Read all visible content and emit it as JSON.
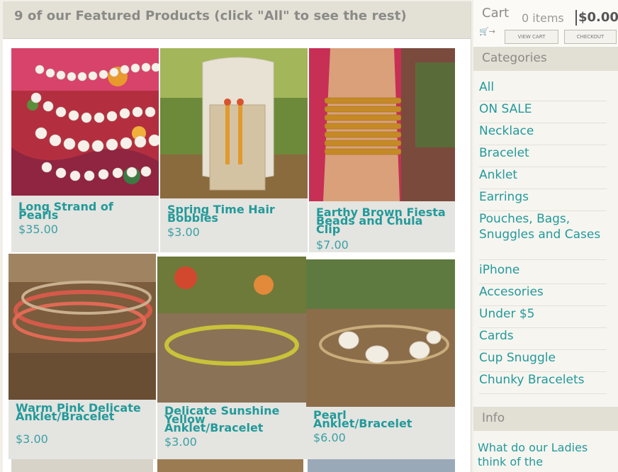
{
  "main": {
    "title": "9 of our Featured Products (click \"All\" to see the rest)",
    "products": [
      {
        "name": "Long Strand of Pearls",
        "price": "$35.00"
      },
      {
        "name": "Spring Time Hair Bobbles",
        "price": "$3.00"
      },
      {
        "name": "Earthy Brown Fiesta Beads and Chula Clip",
        "price": "$7.00"
      },
      {
        "name": "Warm Pink Delicate Anklet/Bracelet",
        "price": "$3.00"
      },
      {
        "name": "Delicate Sunshine Yellow Anklet/Bracelet",
        "price": "$3.00"
      },
      {
        "name": "Pearl Anklet/Bracelet",
        "price": "$6.00"
      }
    ]
  },
  "cart": {
    "label": "Cart",
    "items": "0 items",
    "total": "$0.00",
    "view_cart": "VIEW CART",
    "checkout": "CHECKOUT"
  },
  "categories": {
    "title": "Categories",
    "items": [
      "All",
      "ON SALE",
      "Necklace",
      "Bracelet",
      "Anklet",
      "Earrings",
      "Pouches, Bags, Snuggles and Cases",
      "iPhone",
      "Accesories",
      "Under $5",
      "Cards",
      "Cup Snuggle",
      "Chunky Bracelets"
    ]
  },
  "info": {
    "title": "Info",
    "link": "What do our Ladies think of the"
  },
  "colors": {
    "accent": "#239a9a",
    "frame": "#c9572d",
    "panel": "#e2dfd4"
  }
}
